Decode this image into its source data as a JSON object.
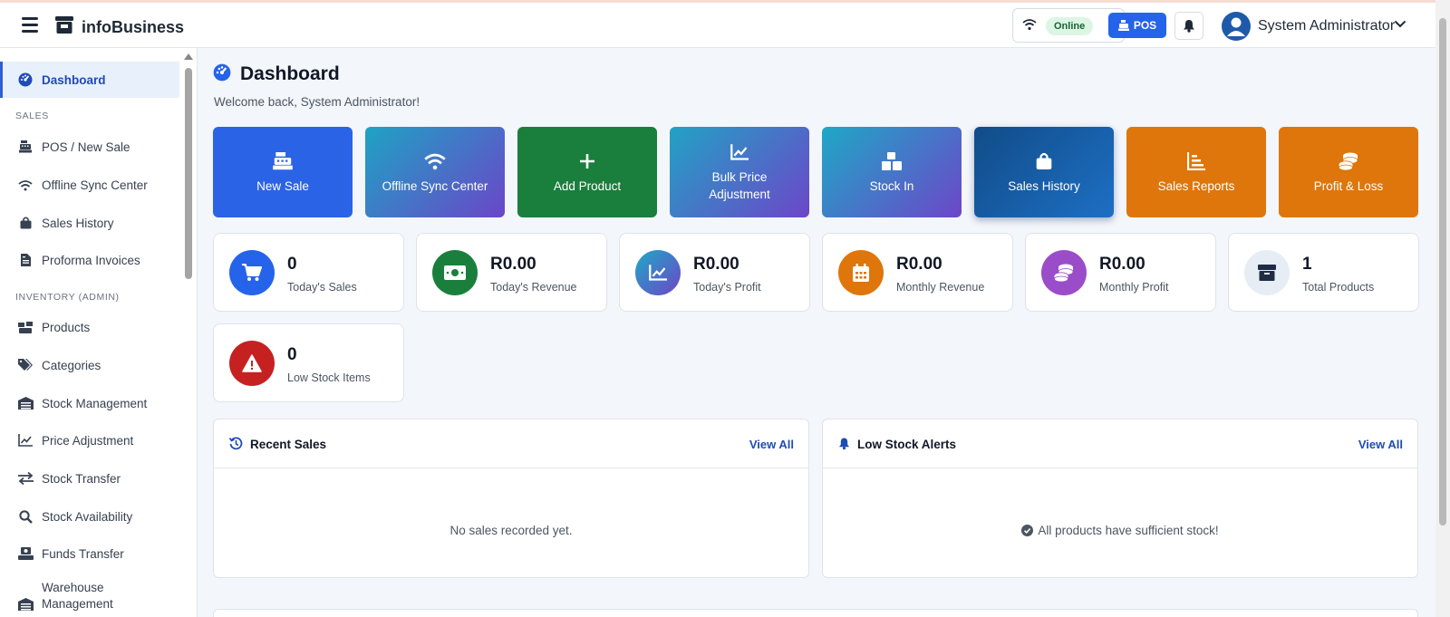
{
  "header": {
    "brand": "infoBusiness",
    "online_label": "Online",
    "pos_label": "POS",
    "user_name": "System Administrator"
  },
  "sidebar": {
    "active": {
      "label": "Dashboard",
      "icon": "dashboard-gauge-icon"
    },
    "sections": [
      {
        "title": "SALES",
        "items": [
          {
            "label": "POS / New Sale",
            "icon": "cash-register-icon"
          },
          {
            "label": "Offline Sync Center",
            "icon": "wifi-icon"
          },
          {
            "label": "Sales History",
            "icon": "shopping-bag-icon"
          },
          {
            "label": "Proforma Invoices",
            "icon": "invoice-icon"
          }
        ]
      },
      {
        "title": "INVENTORY (ADMIN)",
        "items": [
          {
            "label": "Products",
            "icon": "boxes-icon"
          },
          {
            "label": "Categories",
            "icon": "tags-icon"
          },
          {
            "label": "Stock Management",
            "icon": "warehouse-icon"
          },
          {
            "label": "Price Adjustment",
            "icon": "line-chart-icon"
          },
          {
            "label": "Stock Transfer",
            "icon": "transfer-arrows-icon"
          },
          {
            "label": "Stock Availability",
            "icon": "search-icon"
          },
          {
            "label": "Funds Transfer",
            "icon": "money-transfer-icon"
          },
          {
            "label": "Warehouse Management",
            "icon": "warehouse-icon"
          }
        ]
      }
    ]
  },
  "page": {
    "title": "Dashboard",
    "welcome": "Welcome back, System Administrator!"
  },
  "quick_actions": [
    {
      "label": "New Sale",
      "icon": "cash-register-icon",
      "bg": "#2b63e6"
    },
    {
      "label": "Offline Sync Center",
      "icon": "wifi-icon",
      "bg": "linear-gradient(135deg,#1ea3c4,#6b46c8)"
    },
    {
      "label": "Add Product",
      "icon": "plus-icon",
      "bg": "#1a7f3c"
    },
    {
      "label": "Bulk Price Adjustment",
      "icon": "line-chart-icon",
      "bg": "linear-gradient(135deg,#22a2c4,#6d46c9)"
    },
    {
      "label": "Stock In",
      "icon": "stacked-boxes-icon",
      "bg": "linear-gradient(135deg,#1ea8c6,#6d46c9)"
    },
    {
      "label": "Sales History",
      "icon": "shopping-bag-icon",
      "bg": "linear-gradient(135deg,#114c88,#1d6fc4)"
    },
    {
      "label": "Sales Reports",
      "icon": "bar-chart-icon",
      "bg": "#de760b"
    },
    {
      "label": "Profit & Loss",
      "icon": "coins-icon",
      "bg": "#de760b"
    }
  ],
  "stats": [
    {
      "value": "0",
      "label": "Today's Sales",
      "icon": "shopping-cart-icon",
      "color": "#2563eb"
    },
    {
      "value": "R0.00",
      "label": "Today's Revenue",
      "icon": "money-bill-icon",
      "color": "#1a7f3c"
    },
    {
      "value": "R0.00",
      "label": "Today's Profit",
      "icon": "line-chart-icon",
      "color": "linear-gradient(135deg,#1ea8c6,#6d46c9)"
    },
    {
      "value": "R0.00",
      "label": "Monthly Revenue",
      "icon": "calendar-icon",
      "color": "#de760b"
    },
    {
      "value": "R0.00",
      "label": "Monthly Profit",
      "icon": "coins-icon",
      "color": "#9b4dc9"
    },
    {
      "value": "1",
      "label": "Total Products",
      "icon": "box-icon",
      "color": "#e7edf5"
    },
    {
      "value": "0",
      "label": "Low Stock Items",
      "icon": "warning-triangle-icon",
      "color": "#c62121"
    }
  ],
  "panels": {
    "recent_sales": {
      "title": "Recent Sales",
      "view_all": "View All",
      "empty": "No sales recorded yet."
    },
    "low_stock": {
      "title": "Low Stock Alerts",
      "view_all": "View All",
      "empty": "All products have sufficient stock!"
    }
  }
}
